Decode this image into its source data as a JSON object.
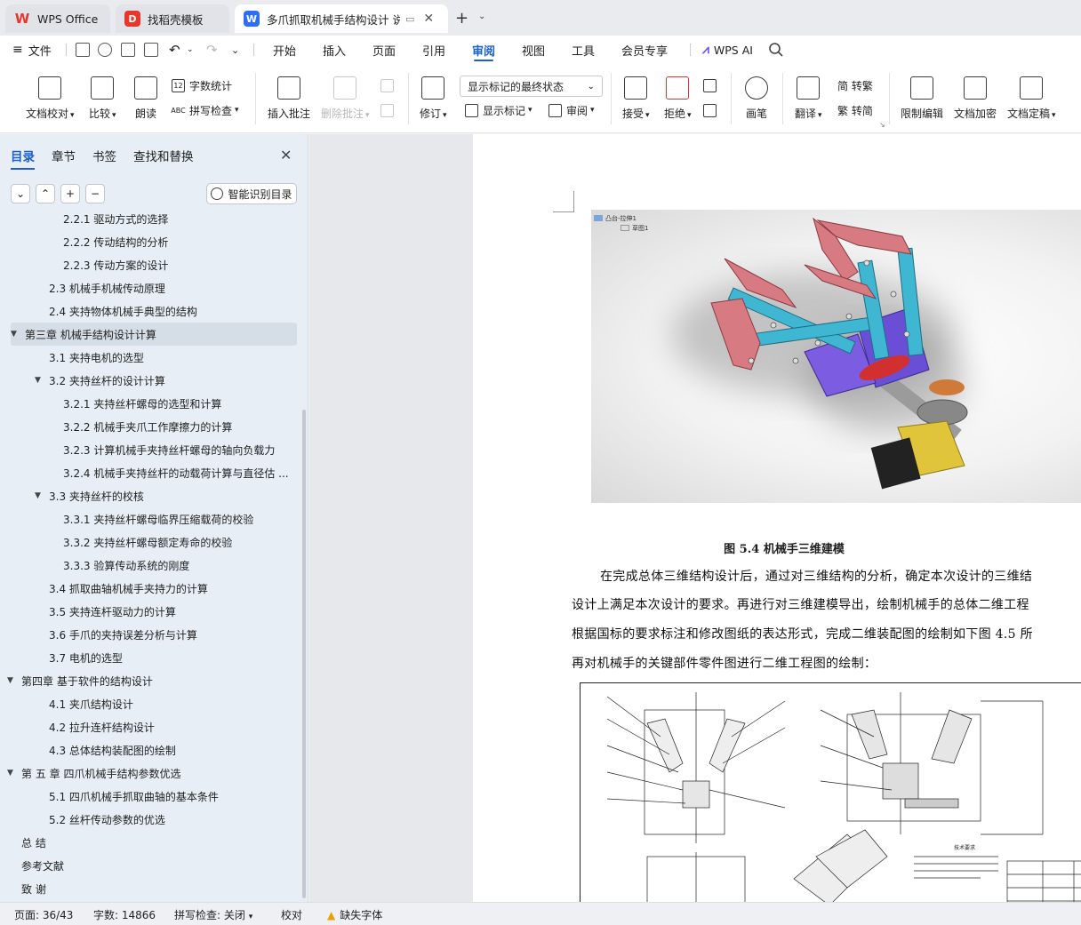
{
  "titlebar": {
    "tabs": [
      {
        "label": "WPS Office"
      },
      {
        "label": "找稻壳模板"
      },
      {
        "label": "多爪抓取机械手结构设计 说明"
      }
    ],
    "new_tab": "+"
  },
  "menubar": {
    "file": "文件",
    "tabs": [
      "开始",
      "插入",
      "页面",
      "引用",
      "审阅",
      "视图",
      "工具",
      "会员专享"
    ],
    "active_tab": "审阅",
    "ai": "WPS AI"
  },
  "ribbon": {
    "proofread": "文档校对",
    "compare": "比较",
    "read_aloud": "朗读",
    "word_count": "字数统计",
    "spell_check": "拼写检查",
    "insert_comment": "插入批注",
    "delete_comment": "删除批注",
    "revise": "修订",
    "markup_state": "显示标记的最终状态",
    "show_markup": "显示标记",
    "review": "审阅",
    "accept": "接受",
    "reject": "拒绝",
    "pen": "画笔",
    "translate": "翻译",
    "to_traditional": "简 转繁",
    "to_simplified": "繁 转简",
    "restrict_edit": "限制编辑",
    "encrypt": "文档加密",
    "finalize": "文档定稿"
  },
  "nav": {
    "tabs": [
      "目录",
      "章节",
      "书签",
      "查找和替换"
    ],
    "active_tab": "目录",
    "smart_toc": "智能识别目录",
    "toc": [
      {
        "label": "2.2.1 驱动方式的选择",
        "level": 3,
        "arrow": ""
      },
      {
        "label": "2.2.2 传动结构的分析",
        "level": 3,
        "arrow": ""
      },
      {
        "label": "2.2.3 传动方案的设计",
        "level": 3,
        "arrow": ""
      },
      {
        "label": "2.3 机械手机械传动原理",
        "level": 2,
        "arrow": ""
      },
      {
        "label": "2.4 夹持物体机械手典型的结构",
        "level": 2,
        "arrow": ""
      },
      {
        "label": "第三章  机械手结构设计计算",
        "level": 1,
        "arrow": "▼"
      },
      {
        "label": "3.1 夹持电机的选型",
        "level": 2,
        "arrow": ""
      },
      {
        "label": "3.2 夹持丝杆的设计计算",
        "level": 2,
        "arrow": "▼"
      },
      {
        "label": "3.2.1 夹持丝杆螺母的选型和计算",
        "level": 3,
        "arrow": ""
      },
      {
        "label": "3.2.2 机械手夹爪工作摩擦力的计算",
        "level": 3,
        "arrow": ""
      },
      {
        "label": "3.2.3 计算机械手夹持丝杆螺母的轴向负载力",
        "level": 3,
        "arrow": ""
      },
      {
        "label": "3.2.4 机械手夹持丝杆的动载荷计算与直径估 ...",
        "level": 3,
        "arrow": ""
      },
      {
        "label": "3.3  夹持丝杆的校核",
        "level": 2,
        "arrow": "▼"
      },
      {
        "label": "3.3.1 夹持丝杆螺母临界压缩载荷的校验",
        "level": 3,
        "arrow": ""
      },
      {
        "label": "3.3.2 夹持丝杆螺母额定寿命的校验",
        "level": 3,
        "arrow": ""
      },
      {
        "label": "3.3.3 验算传动系统的刚度",
        "level": 3,
        "arrow": ""
      },
      {
        "label": "3.4 抓取曲轴机械手夹持力的计算",
        "level": 2,
        "arrow": ""
      },
      {
        "label": "3.5 夹持连杆驱动力的计算",
        "level": 2,
        "arrow": ""
      },
      {
        "label": "3.6 手爪的夹持误差分析与计算",
        "level": 2,
        "arrow": ""
      },
      {
        "label": "3.7 电机的选型",
        "level": 2,
        "arrow": ""
      },
      {
        "label": "第四章  基于软件的结构设计",
        "level": 1,
        "arrow": "▼"
      },
      {
        "label": "4.1  夹爪结构设计",
        "level": 2,
        "arrow": ""
      },
      {
        "label": "4.2  拉升连杆结构设计",
        "level": 2,
        "arrow": ""
      },
      {
        "label": "4.3 总体结构装配图的绘制",
        "level": 2,
        "arrow": ""
      },
      {
        "label": "第 五 章  四爪机械手结构参数优选",
        "level": 1,
        "arrow": "▼"
      },
      {
        "label": "5.1 四爪机械手抓取曲轴的基本条件",
        "level": 2,
        "arrow": ""
      },
      {
        "label": "5.2 丝杆传动参数的优选",
        "level": 2,
        "arrow": ""
      },
      {
        "label": "总 结",
        "level": 1,
        "arrow": ""
      },
      {
        "label": "参考文献",
        "level": 1,
        "arrow": ""
      },
      {
        "label": "致 谢",
        "level": 1,
        "arrow": ""
      }
    ],
    "selected_index": 5
  },
  "document": {
    "sw_tree": [
      "凸台-拉伸1",
      "草图1"
    ],
    "figure_caption": "图 5.4 机械手三维建模",
    "paragraph": [
      "在完成总体三维结构设计后，通过对三维结构的分析，确定本次设计的三维结",
      "设计上满足本次设计的要求。再进行对三维建模导出，绘制机械手的总体二维工程",
      "根据国标的要求标注和修改图纸的表达形式，完成二维装配图的绘制如下图 4.5 所",
      "再对机械手的关键部件零件图进行二维工程图的绘制："
    ],
    "drawing_note_title": "技术要求"
  },
  "statusbar": {
    "page": "页面: 36/43",
    "words": "字数: 14866",
    "spell": "拼写检查: 关闭",
    "proof": "校对",
    "font_missing": "缺失字体"
  },
  "colors": {
    "accent": "#1a5fd6",
    "claw_red": "#d87a82",
    "link_cyan": "#3fb6d2",
    "body_purple": "#6a4fd6",
    "motor_yellow": "#e0c43a"
  }
}
